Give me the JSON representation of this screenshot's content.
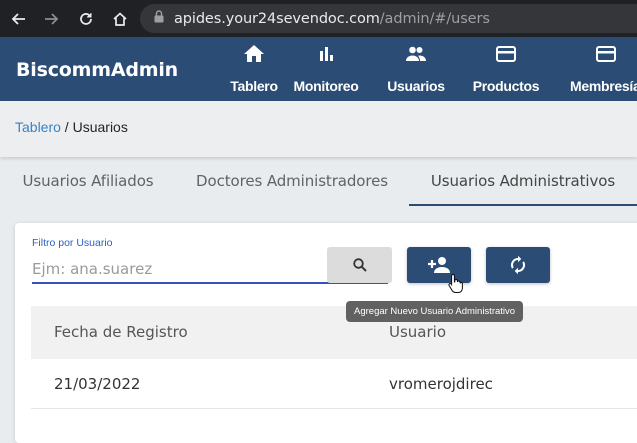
{
  "browser": {
    "url_host": "apides.your24sevendoc.com",
    "url_path": "/admin/#/users"
  },
  "header": {
    "brand": "BiscommAdmin",
    "nav": [
      {
        "label": "Tablero",
        "icon": "home-icon"
      },
      {
        "label": "Monitoreo",
        "icon": "bar-chart-icon"
      },
      {
        "label": "Usuarios",
        "icon": "people-icon"
      },
      {
        "label": "Productos",
        "icon": "card-icon"
      },
      {
        "label": "Membresía",
        "icon": "card-icon"
      }
    ]
  },
  "breadcrumb": {
    "link": "Tablero",
    "separator": " / ",
    "current": "Usuarios"
  },
  "tabs": [
    {
      "label": "Usuarios Afiliados",
      "active": false
    },
    {
      "label": "Doctores Administradores",
      "active": false
    },
    {
      "label": "Usuarios Administrativos",
      "active": true
    }
  ],
  "filter": {
    "label": "Filtro por Usuario",
    "placeholder": "Ejm: ana.suarez",
    "value": ""
  },
  "tooltip": "Agregar Nuevo Usuario Administrativo",
  "table": {
    "columns": [
      "Fecha de Registro",
      "Usuario"
    ],
    "rows": [
      {
        "fecha": "21/03/2022",
        "usuario": "vromerojdirec"
      }
    ]
  },
  "colors": {
    "primary": "#2b4c74",
    "link": "#3b82c4",
    "input_underline": "#3552b8"
  }
}
